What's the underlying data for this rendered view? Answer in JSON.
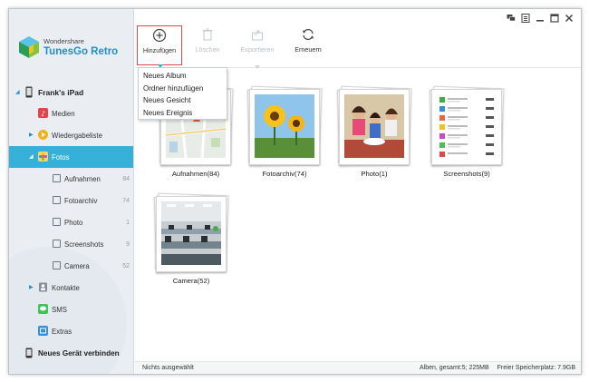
{
  "app": {
    "company": "Wondershare",
    "product": "TunesGo Retro"
  },
  "sidebar": {
    "device": "Frank's iPad",
    "items": [
      {
        "label": "Medien",
        "icon": "media-icon",
        "color": "#e2454a"
      },
      {
        "label": "Wiedergabeliste",
        "icon": "playlist-icon",
        "color": "#f2b21b"
      },
      {
        "label": "Fotos",
        "icon": "photos-icon",
        "color": "#f2c04b"
      }
    ],
    "photo_albums": [
      {
        "label": "Aufnahmen",
        "count": "84"
      },
      {
        "label": "Fotoarchiv",
        "count": "74"
      },
      {
        "label": "Photo",
        "count": "1"
      },
      {
        "label": "Screenshots",
        "count": "9"
      },
      {
        "label": "Camera",
        "count": "52"
      }
    ],
    "more_items": [
      {
        "label": "Kontakte",
        "icon": "contacts-icon"
      },
      {
        "label": "SMS",
        "icon": "sms-icon",
        "color": "#3fc455"
      },
      {
        "label": "Extras",
        "icon": "extras-icon",
        "color": "#3a8ed8"
      }
    ],
    "connect_new": "Neues Gerät verbinden"
  },
  "toolbar": {
    "add": "Hinzufügen",
    "delete": "Löschen",
    "export": "Exportieren",
    "refresh": "Erneuern"
  },
  "add_menu": [
    "Neues Album",
    "Ordner hinzufügen",
    "Neues Gesicht",
    "Neues Ereignis"
  ],
  "albums": [
    {
      "name": "Aufnahmen(84)",
      "thumb": "map"
    },
    {
      "name": "Fotoarchiv(74)",
      "thumb": "sunflower"
    },
    {
      "name": "Photo(1)",
      "thumb": "people"
    },
    {
      "name": "Screenshots(9)",
      "thumb": "screenshot-list"
    },
    {
      "name": "Camera(52)",
      "thumb": "office"
    }
  ],
  "status": {
    "selection": "Nichts ausgewählt",
    "albums_total": "Alben, gesamt:5; 225MB",
    "free_space": "Freier Speicherplatz: 7.9GB"
  },
  "colors": {
    "accent": "#35b1d9",
    "brand_blue": "#1f8ec9",
    "active_border": "#e0474c"
  }
}
